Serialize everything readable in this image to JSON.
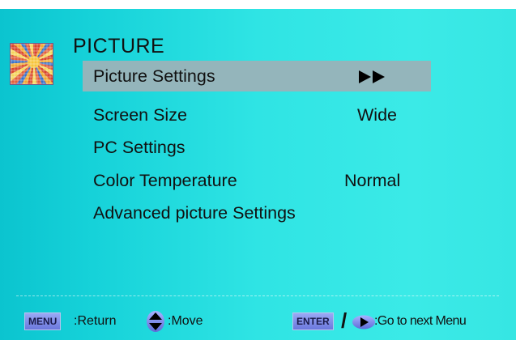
{
  "menu": {
    "title": "PICTURE",
    "items": [
      {
        "label": "Picture Settings",
        "selected": true,
        "indicator": "double-play-arrows-icon"
      },
      {
        "label": "Screen Size",
        "value": "Wide"
      },
      {
        "label": "PC Settings"
      },
      {
        "label": "Color Temperature",
        "value": "Normal"
      },
      {
        "label": "Advanced picture Settings"
      }
    ]
  },
  "footer": {
    "menu_key": "MENU",
    "return_text": ":Return",
    "move_text": ":Move",
    "enter_key": "ENTER",
    "separator": "/",
    "next_text": ":Go to next Menu"
  },
  "icons": {
    "category": "picture-thumbnail-icon",
    "move": "up-down-arrows-icon",
    "next": "right-arrow-button-icon"
  },
  "colors": {
    "background": "#2fe4e4",
    "selection": "#94b5bb",
    "key_button": "#8a98ee",
    "text": "#111111"
  }
}
